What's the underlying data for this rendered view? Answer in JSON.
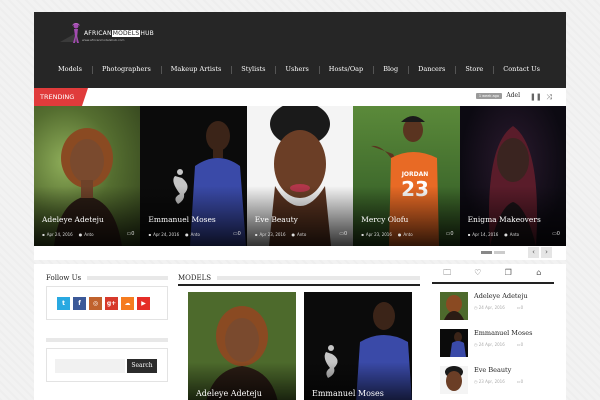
{
  "header": {
    "logo_left": "AFRICAN",
    "logo_hl": "MODELS",
    "logo_right": "HUB",
    "logo_sub": "www.africanmodelshub.com"
  },
  "nav": {
    "items": [
      "Models",
      "Photographers",
      "Makeup Artists",
      "Stylists",
      "Ushers",
      "Hosts/Oap",
      "Blog",
      "Dancers",
      "Store",
      "Contact Us"
    ]
  },
  "trending": {
    "label": "TRENDING",
    "time": "1 week ago",
    "title": "Adel"
  },
  "slides": [
    {
      "title": "Adeleye Adeteju",
      "date": "Apr 24, 2016",
      "author": "Anto",
      "comments": "0"
    },
    {
      "title": "Emmanuel Moses",
      "date": "Apr 24, 2016",
      "author": "Anto",
      "comments": "0"
    },
    {
      "title": "Eve Beauty",
      "date": "Apr 23, 2016",
      "author": "Anto",
      "comments": "0"
    },
    {
      "title": "Mercy Olofu",
      "date": "Apr 23, 2016",
      "author": "Anto",
      "comments": "0"
    },
    {
      "title": "Enigma Makeovers",
      "date": "Apr 14, 2016",
      "author": "Anto",
      "comments": "0"
    }
  ],
  "slide_texts": {
    "slide4_shirt": "23",
    "slide4_shirt_top": "JORDAN"
  },
  "follow": {
    "title": "Follow Us",
    "icons": [
      "twitter-icon",
      "facebook-icon",
      "instagram-icon",
      "google-plus-icon",
      "soundcloud-icon",
      "youtube-icon"
    ]
  },
  "search": {
    "button": "Search",
    "placeholder": ""
  },
  "models": {
    "title": "MODELS",
    "cards": [
      "Adeleye Adeteju",
      "Emmanuel Moses"
    ]
  },
  "sidebar_tabs": [
    "folder-icon",
    "heart-icon",
    "comments-icon",
    "tag-icon"
  ],
  "recent": [
    {
      "title": "Adeleye Adeteju",
      "date": "24 Apr, 2016",
      "comments": "0"
    },
    {
      "title": "Emmanuel Moses",
      "date": "24 Apr, 2016",
      "comments": "0"
    },
    {
      "title": "Eve Beauty",
      "date": "23 Apr, 2016",
      "comments": "0"
    }
  ],
  "colors": {
    "header_bg": "#262626",
    "trending_red": "#e03b3b",
    "twitter": "#29a9e1",
    "facebook": "#3b5998",
    "instagram": "#c0622d",
    "google_plus": "#d7392b",
    "soundcloud": "#f57c1f",
    "youtube": "#e52d27"
  }
}
